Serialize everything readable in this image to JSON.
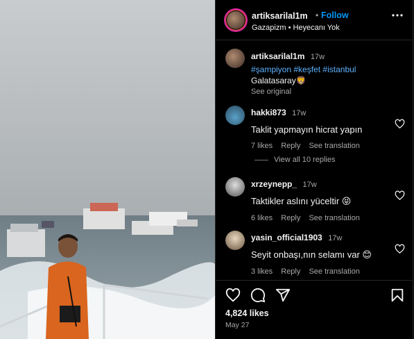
{
  "post": {
    "username": "artiksarilal1m",
    "follow_label": "Follow",
    "audio": "Gazapizm • Heyecanı Yok",
    "likes": "4,824 likes",
    "date": "May 27"
  },
  "caption": {
    "username": "artiksarilal1m",
    "time": "17w",
    "hashtags": [
      "#şampiyon",
      "#keşfet",
      "#istanbul"
    ],
    "text": "Galatasaray🦁",
    "see_original": "See original"
  },
  "comments": [
    {
      "username": "hakki873",
      "time": "17w",
      "text": "Taklit yapmayın hicrat yapın",
      "likes": "7 likes",
      "reply": "Reply",
      "translate": "See translation"
    },
    {
      "username": "xrzeynepp_",
      "time": "17w",
      "text": "Taktikler aslını yüceltir 😝",
      "likes": "6 likes",
      "reply": "Reply",
      "translate": "See translation"
    },
    {
      "username": "yasin_official1903",
      "time": "17w",
      "text": "Seyit onbaşı,nın selamı var 😊",
      "likes": "3 likes",
      "reply": "Reply",
      "translate": "See translation"
    }
  ],
  "view_replies": "View all 10 replies",
  "icons": [
    "heart-icon",
    "comment-icon",
    "share-icon",
    "bookmark-icon"
  ],
  "colors": {
    "accent": "#0095f6",
    "background": "#000000",
    "secondary_text": "#a8a8a8"
  }
}
